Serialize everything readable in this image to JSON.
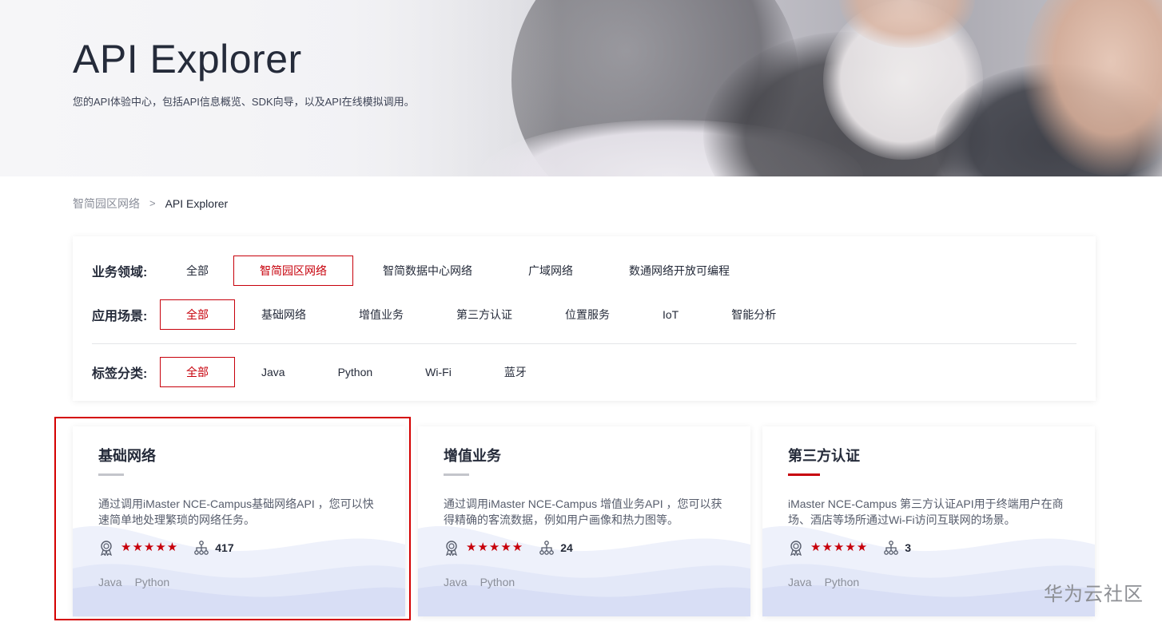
{
  "hero": {
    "title": "API Explorer",
    "subtitle": "您的API体验中心，包括API信息概览、SDK向导，以及API在线模拟调用。"
  },
  "breadcrumb": {
    "parent": "智简园区网络",
    "separator": ">",
    "current": "API Explorer"
  },
  "filters": {
    "domain": {
      "label": "业务领域:",
      "options": [
        "全部",
        "智简园区网络",
        "智简数据中心网络",
        "广域网络",
        "数通网络开放可编程"
      ],
      "selected": "智简园区网络"
    },
    "scenario": {
      "label": "应用场景:",
      "options": [
        "全部",
        "基础网络",
        "增值业务",
        "第三方认证",
        "位置服务",
        "IoT",
        "智能分析"
      ],
      "selected": "全部"
    },
    "tags": {
      "label": "标签分类:",
      "options": [
        "全部",
        "Java",
        "Python",
        "Wi-Fi",
        "蓝牙"
      ],
      "selected": "全部"
    }
  },
  "cards": [
    {
      "title": "基础网络",
      "description": "通过调用iMaster NCE-Campus基础网络API ，您可以快速简单地处理繁琐的网络任务。",
      "stars": "★★★★★",
      "count": "417",
      "tags": [
        "Java",
        "Python"
      ]
    },
    {
      "title": "增值业务",
      "description": "通过调用iMaster NCE-Campus 增值业务API ，您可以获得精确的客流数据，例如用户画像和热力图等。",
      "stars": "★★★★★",
      "count": "24",
      "tags": [
        "Java",
        "Python"
      ]
    },
    {
      "title": "第三方认证",
      "description": "iMaster NCE-Campus 第三方认证API用于终端用户在商场、酒店等场所通过Wi-Fi访问互联网的场景。",
      "stars": "★★★★★",
      "count": "3",
      "tags": [
        "Java",
        "Python"
      ]
    }
  ],
  "icons": {
    "award": "award-icon",
    "tree": "hierarchy-icon"
  },
  "colors": {
    "accent": "#c7000b",
    "highlight_border": "#d40000",
    "text": "#252b3a",
    "muted": "#8a8e99"
  },
  "watermark": "华为云社区"
}
